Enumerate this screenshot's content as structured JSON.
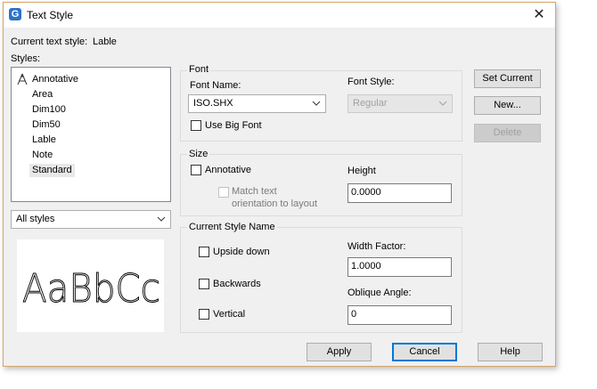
{
  "window": {
    "title": "Text Style",
    "close_symbol": "✕"
  },
  "current_style": {
    "label": "Current text style:",
    "value": "Lable"
  },
  "styles": {
    "label": "Styles:",
    "items": [
      "Annotative",
      "Area",
      "Dim100",
      "Dim50",
      "Lable",
      "Note",
      "Standard"
    ],
    "selected": "Standard",
    "filter": "All styles"
  },
  "preview": {
    "text": "AaBbCc"
  },
  "font": {
    "group_label": "Font",
    "name_label": "Font Name:",
    "name_value": "ISO.SHX",
    "style_label": "Font Style:",
    "style_value": "Regular",
    "big_font_label": "Use Big Font",
    "big_font_checked": false
  },
  "size": {
    "group_label": "Size",
    "annotative_label": "Annotative",
    "annotative_checked": false,
    "match_label_1": "Match text",
    "match_label_2": "orientation to layout",
    "height_label": "Height",
    "height_value": "0.0000"
  },
  "effects": {
    "group_label": "Current Style Name",
    "upside_down": "Upside down",
    "backwards": "Backwards",
    "vertical": "Vertical",
    "width_label": "Width Factor:",
    "width_value": "1.0000",
    "oblique_label": "Oblique Angle:",
    "oblique_value": "0"
  },
  "buttons": {
    "set_current": "Set Current",
    "new": "New...",
    "delete": "Delete",
    "apply": "Apply",
    "cancel": "Cancel",
    "help": "Help"
  },
  "colors": {
    "accent": "#0078d7",
    "frame": "#d7a467"
  }
}
